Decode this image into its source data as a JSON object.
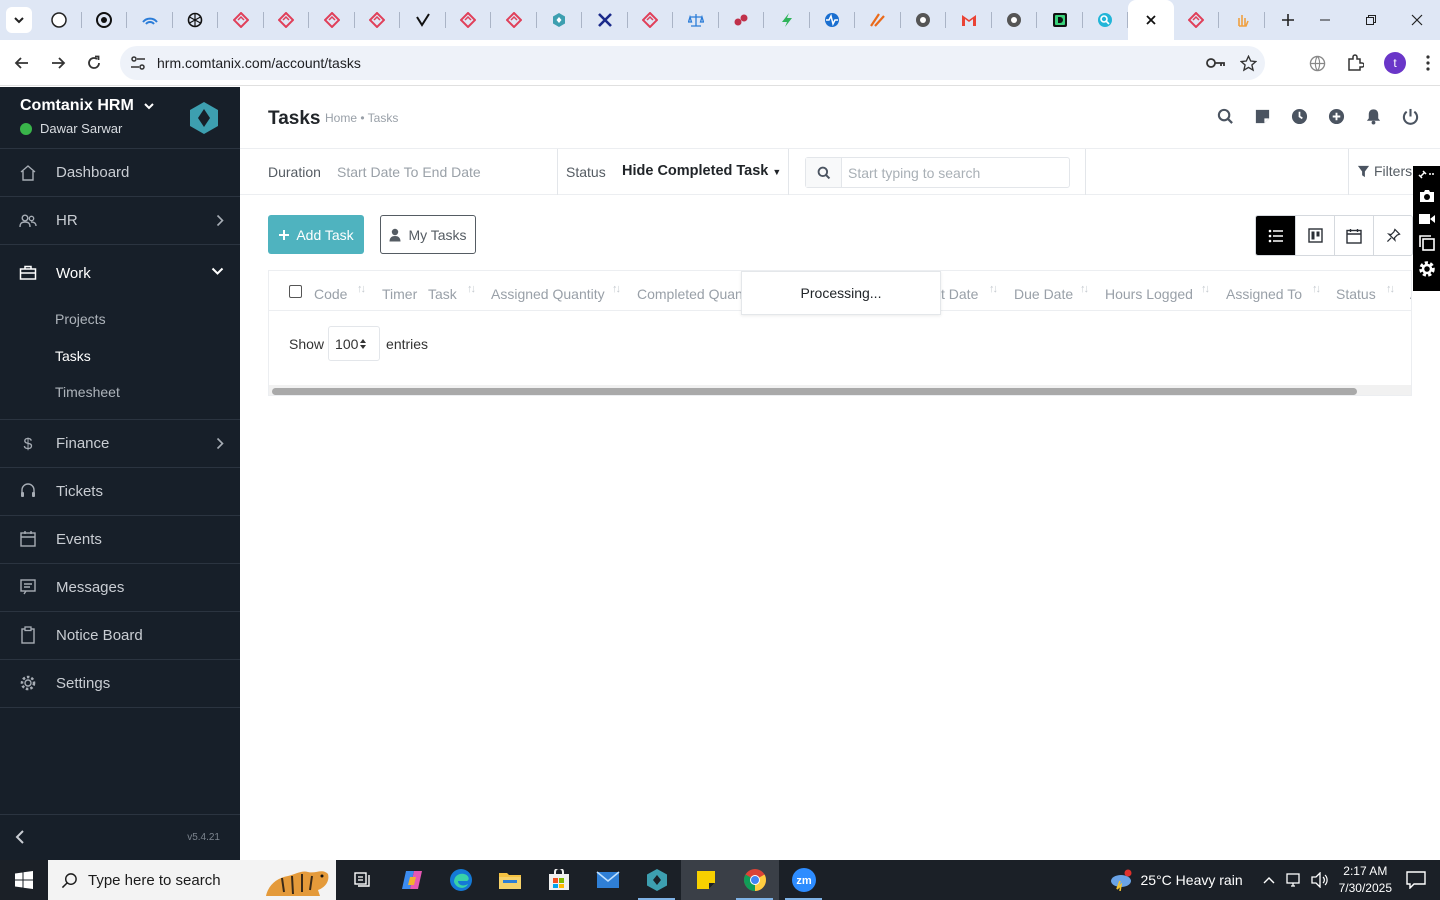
{
  "browser": {
    "tabs": [
      {
        "icon": "chrome-tabs-icon"
      },
      {
        "icon": "circle-logo-icon"
      },
      {
        "icon": "wifi-logo-icon"
      },
      {
        "icon": "openai-icon"
      },
      {
        "icon": "diamond-red-icon"
      },
      {
        "icon": "diamond-red-icon"
      },
      {
        "icon": "diamond-red-icon"
      },
      {
        "icon": "diamond-red-icon"
      },
      {
        "icon": "check-mark-icon"
      },
      {
        "icon": "diamond-red-icon"
      },
      {
        "icon": "diamond-red-icon"
      },
      {
        "icon": "hexagon-teal-icon"
      },
      {
        "icon": "x-blue-icon"
      },
      {
        "icon": "diamond-red-icon"
      },
      {
        "icon": "scales-icon"
      },
      {
        "icon": "dots-red-icon"
      },
      {
        "icon": "lightning-icon"
      },
      {
        "icon": "pulse-icon"
      },
      {
        "icon": "stroke-orange-icon"
      },
      {
        "icon": "circle-grey-icon"
      },
      {
        "icon": "gmail-icon"
      },
      {
        "icon": "circle-grey-icon"
      },
      {
        "icon": "d-green-icon"
      },
      {
        "icon": "search-circle-icon"
      },
      {
        "icon": "close-icon",
        "active": true
      },
      {
        "icon": "diamond-red-icon"
      },
      {
        "icon": "hand-icon"
      }
    ],
    "url": "hrm.comtanix.com/account/tasks",
    "profile_initial": "t"
  },
  "sidebar": {
    "brand": "Comtanix HRM",
    "user": "Dawar Sarwar",
    "items": [
      {
        "label": "Dashboard",
        "icon": "home-icon"
      },
      {
        "label": "HR",
        "icon": "users-icon",
        "chevron": "right"
      },
      {
        "label": "Work",
        "icon": "briefcase-icon",
        "chevron": "down",
        "open": true
      },
      {
        "label": "Finance",
        "icon": "dollar-icon",
        "chevron": "right"
      },
      {
        "label": "Tickets",
        "icon": "headset-icon"
      },
      {
        "label": "Events",
        "icon": "calendar-icon"
      },
      {
        "label": "Messages",
        "icon": "message-icon"
      },
      {
        "label": "Notice Board",
        "icon": "clipboard-icon"
      },
      {
        "label": "Settings",
        "icon": "gear-icon"
      }
    ],
    "work_submenu": [
      "Projects",
      "Tasks",
      "Timesheet"
    ],
    "active_sub": "Tasks",
    "version": "v5.4.21"
  },
  "header": {
    "title": "Tasks",
    "breadcrumb": "Home • Tasks"
  },
  "filters": {
    "duration_label": "Duration",
    "duration_value": "Start Date To End Date",
    "status_label": "Status",
    "status_value": "Hide Completed Task",
    "search_placeholder": "Start typing to search",
    "filters_label": "Filters"
  },
  "actions": {
    "add_task": "Add Task",
    "my_tasks": "My Tasks"
  },
  "table": {
    "columns": [
      "Code",
      "Timer",
      "Task",
      "Assigned Quantity",
      "Completed Quant",
      "t Date",
      "Due Date",
      "Hours Logged",
      "Assigned To",
      "Status",
      "A"
    ],
    "processing": "Processing...",
    "show_label": "Show",
    "page_size": "100",
    "entries_label": "entries"
  },
  "taskbar": {
    "search_placeholder": "Type here to search",
    "weather": "25°C  Heavy rain",
    "time": "2:17 AM",
    "date": "7/30/2025"
  },
  "colors": {
    "sidebar_bg": "#171f29",
    "accent_teal": "#4fb3bf",
    "online_green": "#39b54a"
  }
}
